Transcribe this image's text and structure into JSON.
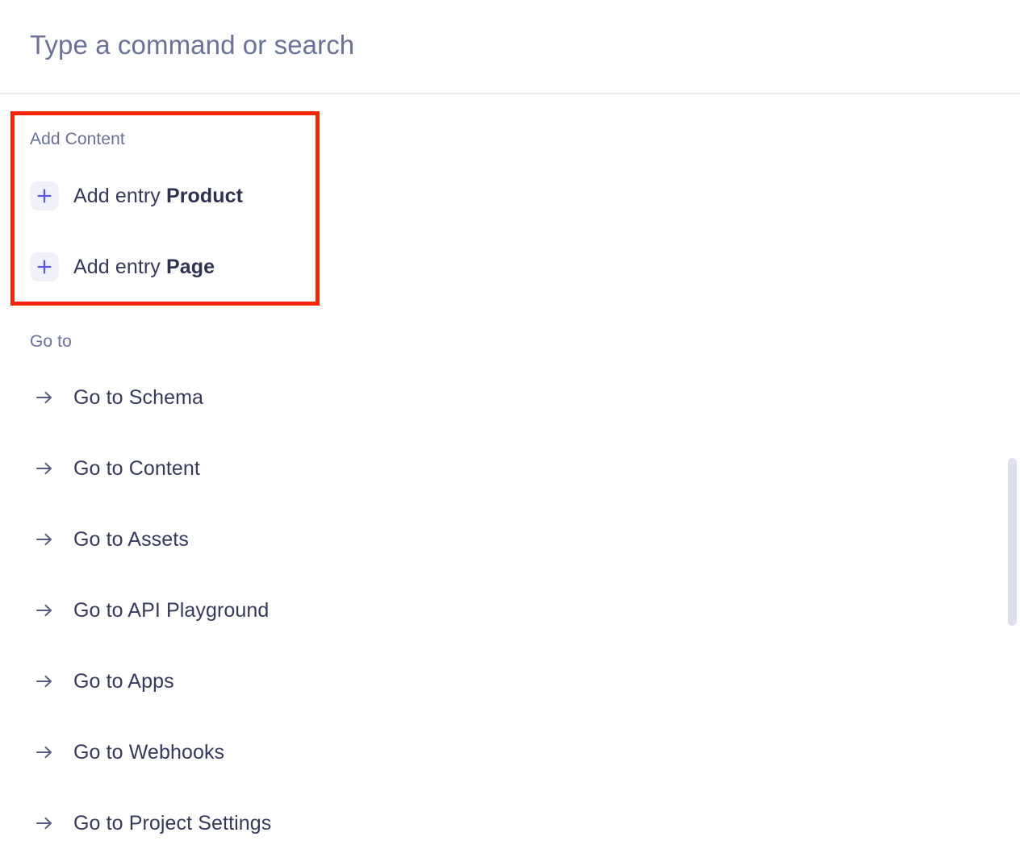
{
  "search": {
    "placeholder": "Type a command or search",
    "value": ""
  },
  "sections": [
    {
      "title": "Add Content",
      "items": [
        {
          "icon": "plus-icon",
          "prefix": "Add entry ",
          "strong": "Product"
        },
        {
          "icon": "plus-icon",
          "prefix": "Add entry ",
          "strong": "Page"
        }
      ]
    },
    {
      "title": "Go to",
      "items": [
        {
          "icon": "arrow-right-icon",
          "label": "Go to Schema"
        },
        {
          "icon": "arrow-right-icon",
          "label": "Go to Content"
        },
        {
          "icon": "arrow-right-icon",
          "label": "Go to Assets"
        },
        {
          "icon": "arrow-right-icon",
          "label": "Go to API Playground"
        },
        {
          "icon": "arrow-right-icon",
          "label": "Go to Apps"
        },
        {
          "icon": "arrow-right-icon",
          "label": "Go to Webhooks"
        },
        {
          "icon": "arrow-right-icon",
          "label": "Go to Project Settings"
        }
      ]
    }
  ],
  "annotation": {
    "type": "highlight-rectangle",
    "color": "#f92500"
  },
  "colors": {
    "accent": "#5b55e0",
    "icon_badge_bg": "#f1f1fa",
    "text_primary": "#363a5a",
    "text_muted": "#6b7198",
    "divider": "#ebecf3",
    "scrollbar_thumb": "#dedfec"
  }
}
